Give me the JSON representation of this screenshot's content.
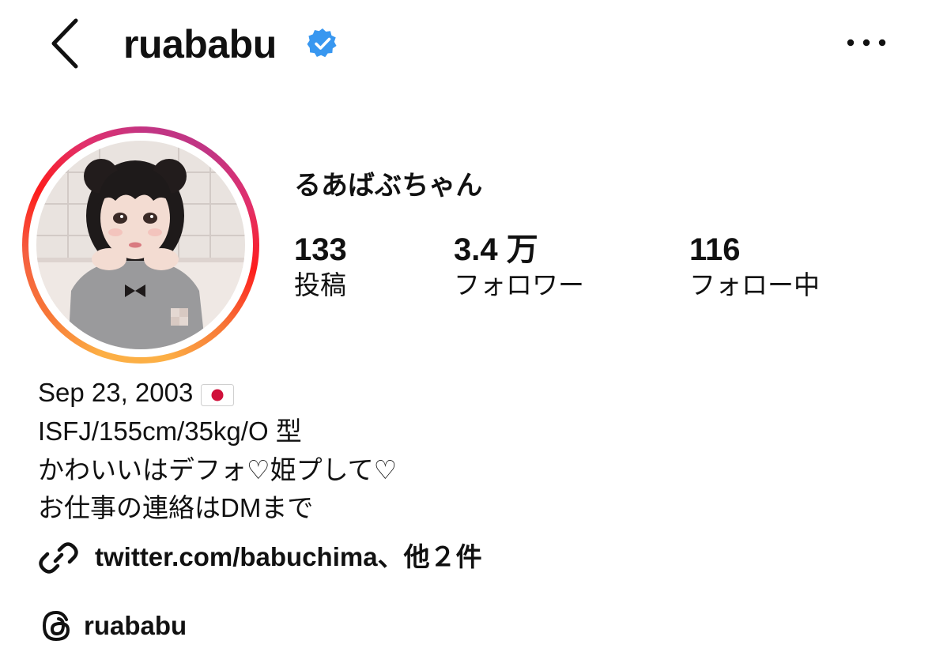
{
  "header": {
    "username": "ruababu",
    "verified_icon": "verified-badge-icon",
    "back_icon": "chevron-left-icon",
    "more_icon": "more-horizontal-icon"
  },
  "profile": {
    "display_name": "るあばぶちゃん",
    "avatar_icon": "profile-avatar",
    "stats": {
      "posts": {
        "value": "133",
        "label": "投稿"
      },
      "followers": {
        "value": "3.4 万",
        "label": "フォロワー"
      },
      "following": {
        "value": "116",
        "label": "フォロー中"
      }
    }
  },
  "bio": {
    "birthday": "Sep 23, 2003",
    "flag_icon": "japan-flag-icon",
    "line2": "ISFJ/155cm/35kg/O 型",
    "line3": "かわいいはデフォ♡姫プして♡",
    "line4": "お仕事の連絡はDMまで"
  },
  "links": {
    "link_text": "twitter.com/babuchima、他２件",
    "threads_handle": "ruababu"
  },
  "colors": {
    "verified_blue": "#3897f0",
    "text": "#111111",
    "ring_gradient": [
      "#fcaf45",
      "#f77737",
      "#fd1d1d",
      "#e1306c",
      "#c13584"
    ]
  }
}
